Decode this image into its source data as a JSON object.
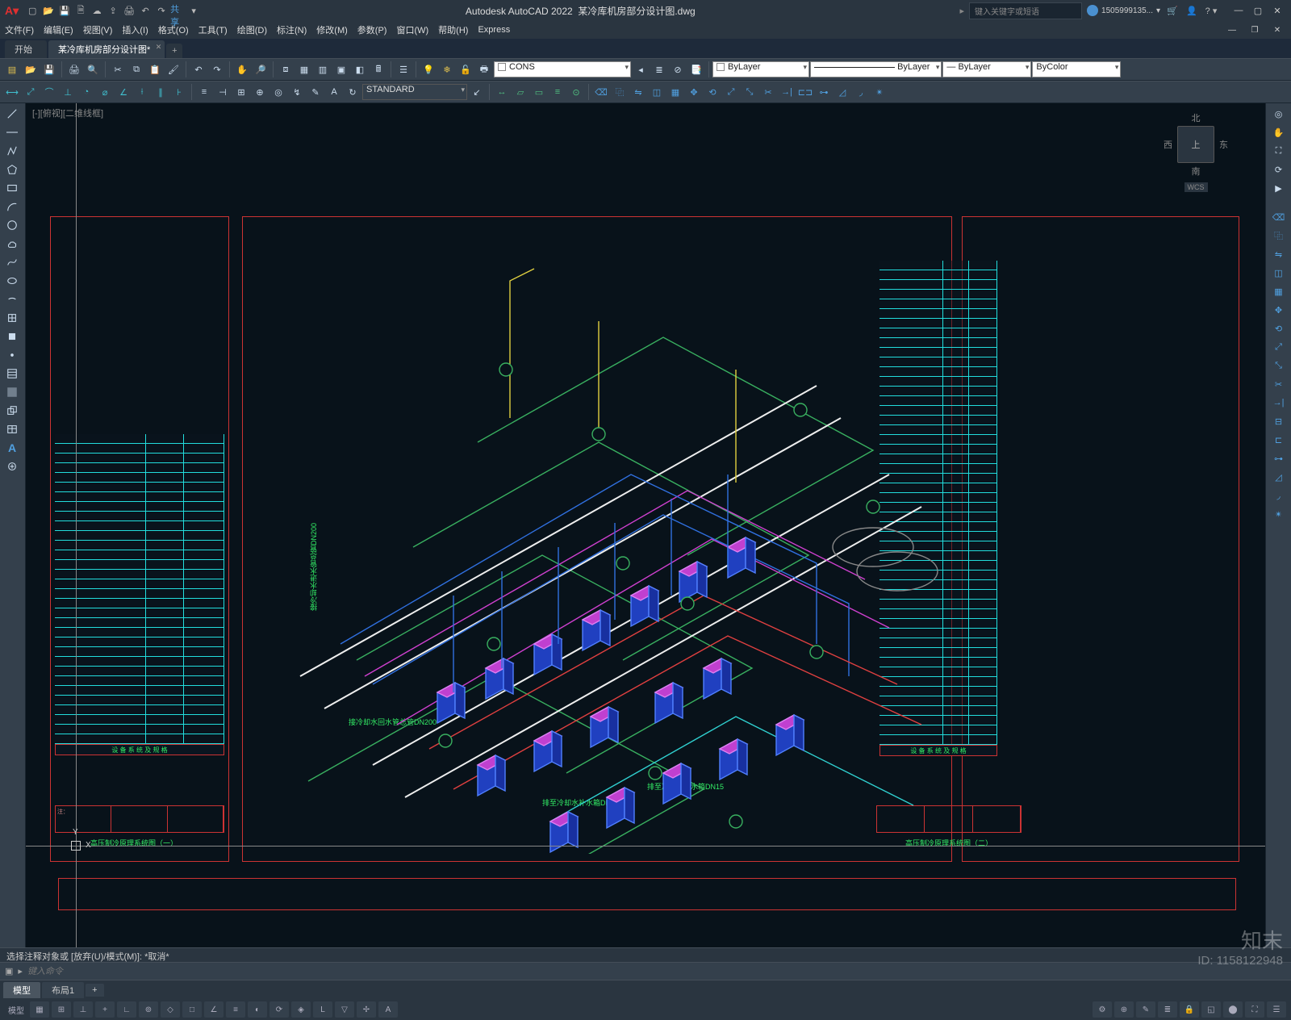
{
  "app_title": "Autodesk AutoCAD 2022",
  "doc_title": "某冷库机房部分设计图.dwg",
  "search_placeholder": "键入关键字或短语",
  "user_name": "1505999135...",
  "menus": [
    "文件(F)",
    "编辑(E)",
    "视图(V)",
    "插入(I)",
    "格式(O)",
    "工具(T)",
    "绘图(D)",
    "标注(N)",
    "修改(M)",
    "参数(P)",
    "窗口(W)",
    "帮助(H)",
    "Express"
  ],
  "file_tabs": {
    "start": "开始",
    "active": "某冷库机房部分设计图*",
    "add": "+"
  },
  "layer_combo": "CONS",
  "linetype_combo": "ByLayer",
  "lineweight_combo": "ByLayer",
  "lineweight2_combo": "ByLayer",
  "color_combo": "ByColor",
  "textstyle_combo": "STANDARD",
  "view_label": "[-][俯视][二维线框]",
  "viewcube": {
    "n": "北",
    "s": "南",
    "e": "东",
    "w": "西",
    "top": "上",
    "wcs": "WCS"
  },
  "ucs": {
    "x": "X",
    "y": "Y"
  },
  "cmd_history": "选择注释对象或 [放弃(U)/模式(M)]: *取消*",
  "cmd_placeholder": "键入命令",
  "cmd_prompt_icon": "▸",
  "layout_tabs": {
    "model": "模型",
    "layout1": "布局1",
    "add": "+"
  },
  "status_text": "模型",
  "drawing": {
    "caption_left": "高压制冷原理系统图（一）",
    "caption_right": "高压制冷原理系统图（二）",
    "title_left": "设 备 系 统 及 规 格",
    "title_right": "设 备 系 统 及 规 格",
    "note_left": "注：",
    "side_label_1": "接冷却水进水管总管DN200",
    "side_label_2": "接冷却水回水管总管DN200",
    "side_label_3": "排至冷却水补水箱DN15",
    "side_label_4": "排至冷却水补水箱DN15"
  },
  "watermark": {
    "brand": "知末",
    "id": "ID: 1158122948"
  }
}
